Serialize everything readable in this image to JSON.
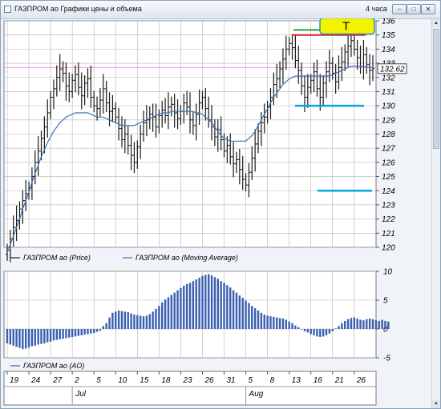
{
  "window": {
    "title": "ГАЗПРОМ ао Графики цены и объема",
    "period": "4 часа",
    "minimize_glyph": "–",
    "maximize_glyph": "□",
    "close_glyph": "✕"
  },
  "chart_data": [
    {
      "type": "ohlc",
      "ylim": [
        120,
        136
      ],
      "yticks": [
        120,
        121,
        122,
        123,
        124,
        125,
        126,
        127,
        128,
        129,
        130,
        131,
        132,
        133,
        134,
        135,
        136
      ],
      "last_price_label": "132.62",
      "last_price": 132.62,
      "price_line": 132.7,
      "annotation_text": "T",
      "legend": [
        "ГАЗПРОМ ао (Price)",
        "ГАЗПРОМ ао (Moving Average)"
      ],
      "colors": {
        "price": "#1a1a1a",
        "ma": "#3a70b8",
        "level_lines": "#00a7e0",
        "red_line": "#e02020",
        "green_line": "#22a43c",
        "annotation_fill": "#f5f200",
        "price_line": "#e7a0e7"
      },
      "support_levels": [
        130,
        124
      ],
      "resistance_levels": [
        135,
        135.3
      ],
      "price_close": [
        119.8,
        120.6,
        121.4,
        121.9,
        122.7,
        123.3,
        123.8,
        124.2,
        125.0,
        126.0,
        126.8,
        127.7,
        128.5,
        129.5,
        130.6,
        131.2,
        132.0,
        132.6,
        132.3,
        131.4,
        131.0,
        131.8,
        132.2,
        131.3,
        130.7,
        131.6,
        131.9,
        130.6,
        130.0,
        129.8,
        130.4,
        131.2,
        130.2,
        129.6,
        129.8,
        129.2,
        128.4,
        127.6,
        128.0,
        127.2,
        126.5,
        126.0,
        127.1,
        128.0,
        128.8,
        129.0,
        129.4,
        129.2,
        128.5,
        129.3,
        129.7,
        129.3,
        129.9,
        130.1,
        129.5,
        129.1,
        129.6,
        130.2,
        129.9,
        129.0,
        128.6,
        129.4,
        130.2,
        130.6,
        129.8,
        129.0,
        128.5,
        127.8,
        128.3,
        127.6,
        126.8,
        127.2,
        126.4,
        125.9,
        126.2,
        125.5,
        124.8,
        124.4,
        125.3,
        126.3,
        127.3,
        128.2,
        128.8,
        129.2,
        129.9,
        130.6,
        131.5,
        131.9,
        132.6,
        133.3,
        134.0,
        134.4,
        134.1,
        133.2,
        132.5,
        131.4,
        130.6,
        131.3,
        131.8,
        132.4,
        131.2,
        130.6,
        131.6,
        132.4,
        133.0,
        132.3,
        131.7,
        132.7,
        133.1,
        133.8,
        134.2,
        134.6,
        134.0,
        133.4,
        132.8,
        133.6,
        132.9,
        132.5,
        132.62
      ],
      "ma_values": [
        119.8,
        120.2,
        120.8,
        121.4,
        122.0,
        122.7,
        123.3,
        123.9,
        124.6,
        125.2,
        125.8,
        126.4,
        126.9,
        127.4,
        127.8,
        128.2,
        128.5,
        128.8,
        129.0,
        129.2,
        129.3,
        129.4,
        129.5,
        129.5,
        129.5,
        129.5,
        129.5,
        129.4,
        129.3,
        129.2,
        129.2,
        129.2,
        129.1,
        129.0,
        128.9,
        128.8,
        128.7,
        128.6,
        128.6,
        128.6,
        128.6,
        128.6,
        128.7,
        128.8,
        128.9,
        129.0,
        129.1,
        129.2,
        129.3,
        129.4,
        129.5,
        129.5,
        129.5,
        129.6,
        129.6,
        129.6,
        129.6,
        129.6,
        129.6,
        129.6,
        129.6,
        129.5,
        129.5,
        129.4,
        129.2,
        129.0,
        128.8,
        128.5,
        128.2,
        127.9,
        127.7,
        127.6,
        127.5,
        127.5,
        127.5,
        127.5,
        127.5,
        127.5,
        127.7,
        127.9,
        128.2,
        128.6,
        129.0,
        129.4,
        129.8,
        130.2,
        130.6,
        130.9,
        131.2,
        131.5,
        131.7,
        131.9,
        132.0,
        132.1,
        132.1,
        132.1,
        132.1,
        132.1,
        132.1,
        132.1,
        132.1,
        132.1,
        132.1,
        132.1,
        132.1,
        132.2,
        132.3,
        132.4,
        132.5,
        132.6,
        132.7,
        132.8,
        132.8,
        132.8,
        132.8,
        132.8,
        132.7,
        132.7,
        132.7
      ]
    },
    {
      "type": "bar",
      "ylim": [
        -5,
        10
      ],
      "yticks": [
        -5,
        0,
        5,
        10
      ],
      "legend": [
        "ГАЗПРОМ ао (AO)"
      ],
      "color": "#3a5fb0",
      "values": [
        -2.5,
        -2.7,
        -2.9,
        -3.1,
        -3.3,
        -3.5,
        -3.4,
        -3.2,
        -3.0,
        -2.9,
        -2.7,
        -2.6,
        -2.5,
        -2.3,
        -2.2,
        -2.0,
        -1.9,
        -1.8,
        -1.7,
        -1.6,
        -1.5,
        -1.4,
        -1.3,
        -1.2,
        -1.1,
        -1.0,
        -0.9,
        -0.8,
        -0.7,
        -0.5,
        -0.3,
        0.5,
        1.0,
        2.0,
        2.8,
        3.0,
        3.2,
        3.1,
        3.0,
        2.9,
        2.7,
        2.5,
        2.4,
        2.3,
        2.2,
        2.3,
        2.6,
        3.0,
        3.5,
        4.0,
        4.6,
        5.1,
        5.5,
        5.9,
        6.3,
        6.7,
        7.1,
        7.5,
        7.8,
        8.0,
        8.3,
        8.6,
        8.9,
        9.2,
        9.4,
        9.5,
        9.3,
        9.0,
        8.7,
        8.3,
        8.0,
        7.6,
        7.2,
        6.7,
        6.3,
        5.8,
        5.4,
        4.9,
        4.5,
        4.0,
        3.6,
        3.2,
        2.8,
        2.5,
        2.3,
        2.2,
        2.1,
        2.0,
        1.9,
        1.8,
        1.6,
        1.3,
        1.0,
        0.6,
        0.3,
        -0.1,
        -0.4,
        -0.6,
        -0.9,
        -1.1,
        -1.3,
        -1.4,
        -1.3,
        -1.1,
        -0.8,
        -0.4,
        0.1,
        0.5,
        1.0,
        1.4,
        1.7,
        1.9,
        2.0,
        1.8,
        1.6,
        1.5,
        1.7,
        1.8,
        1.7,
        1.5,
        1.4,
        1.6,
        1.4,
        1.3
      ],
      "x_tick_labels": [
        "19",
        "24",
        "27",
        "2",
        "5",
        "10",
        "15",
        "18",
        "23",
        "26",
        "31",
        "5",
        "8",
        "13",
        "16",
        "21",
        "26"
      ],
      "month_labels": [
        "Jul",
        "Aug"
      ]
    }
  ]
}
